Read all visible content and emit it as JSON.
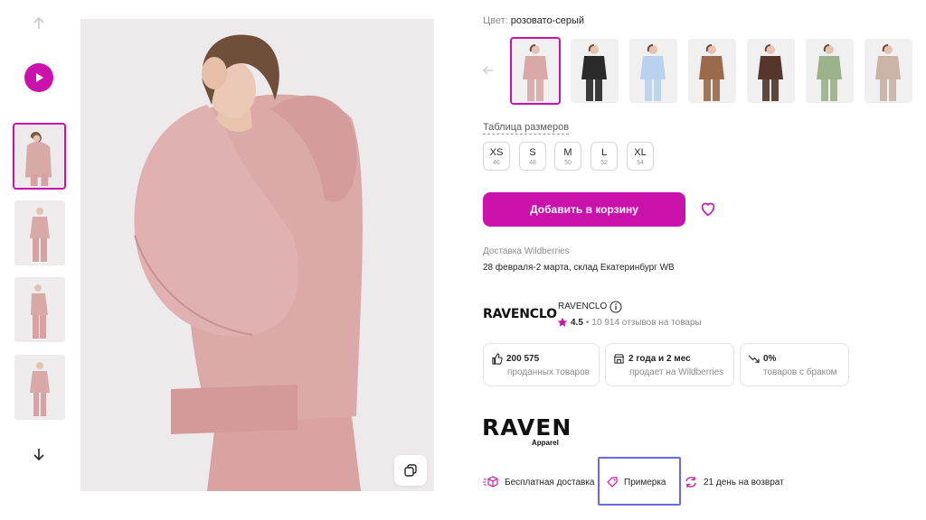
{
  "color": {
    "label": "Цвет:",
    "value": "розовато-серый",
    "swatches": [
      {
        "name": "pink-grey",
        "shade": "#d9a9a8",
        "active": true
      },
      {
        "name": "black",
        "shade": "#2a2a2a",
        "active": false
      },
      {
        "name": "light-blue",
        "shade": "#b9d2ee",
        "active": false
      },
      {
        "name": "camel",
        "shade": "#9a6a4b",
        "active": false
      },
      {
        "name": "dark-brown",
        "shade": "#54362b",
        "active": false
      },
      {
        "name": "sage",
        "shade": "#9cb28a",
        "active": false
      },
      {
        "name": "beige",
        "shade": "#c9b4a6",
        "active": false
      }
    ]
  },
  "sizes": {
    "table_link": "Таблица размеров",
    "items": [
      {
        "size": "XS",
        "ru": "46"
      },
      {
        "size": "S",
        "ru": "48"
      },
      {
        "size": "M",
        "ru": "50"
      },
      {
        "size": "L",
        "ru": "52"
      },
      {
        "size": "XL",
        "ru": "54"
      }
    ]
  },
  "cart": {
    "add_label": "Добавить в корзину"
  },
  "delivery": {
    "title": "Доставка Wildberries",
    "date": "28 февраля-2 марта, склад Екатеринбург WB"
  },
  "seller": {
    "logo_text": "RAVENCLO",
    "name": "RAVENCLO",
    "rating": "4.5",
    "reviews": "10 914 отзывов на товары"
  },
  "stats": [
    {
      "value": "200 575",
      "caption": "проданных товаров",
      "icon": "thumbs-up-icon"
    },
    {
      "value": "2 года и 2 мес",
      "caption": "продает на Wildberries",
      "icon": "store-icon"
    },
    {
      "value": "0%",
      "caption": "товаров с браком",
      "icon": "trend-down-icon"
    }
  ],
  "brand": {
    "name": "RAVEN",
    "sub": "Apparel"
  },
  "perks": [
    {
      "label": "Бесплатная доставка",
      "icon": "box-icon"
    },
    {
      "label": "Примерка",
      "icon": "tag-icon"
    },
    {
      "label": "21 день на возврат",
      "icon": "refresh-icon"
    }
  ],
  "colors": {
    "accent": "#cb11ab",
    "highlight": "#6b68e0",
    "product": "#d9a9a8"
  }
}
